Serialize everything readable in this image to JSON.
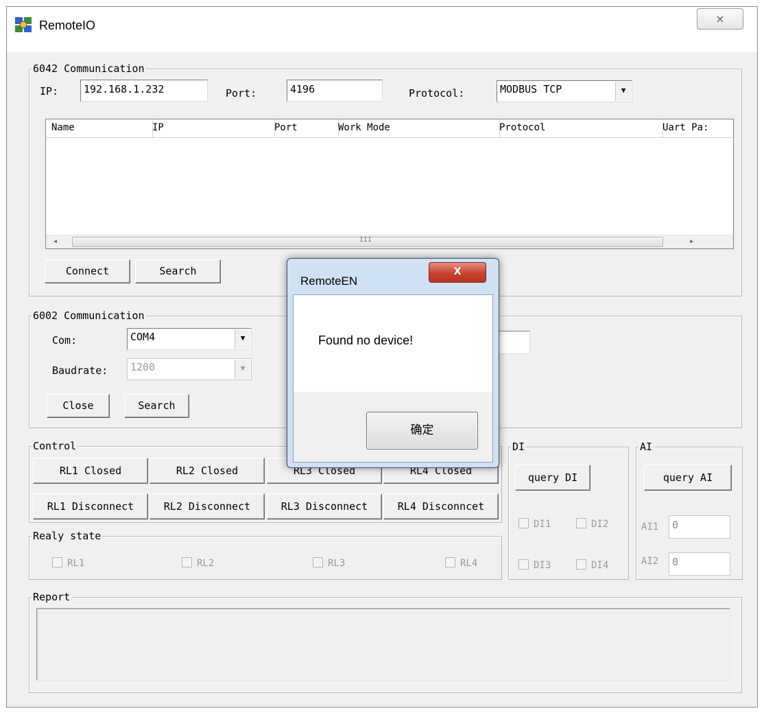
{
  "window": {
    "title": "RemoteIO",
    "close_glyph": "⨯"
  },
  "comm6042": {
    "group_label": "6042 Communication",
    "ip_label": "IP:",
    "ip_value": "192.168.1.232",
    "port_label": "Port:",
    "port_value": "4196",
    "protocol_label": "Protocol:",
    "protocol_value": "MODBUS TCP",
    "columns": [
      "Name",
      "IP",
      "Port",
      "Work Mode",
      "Protocol",
      "Uart Pa:"
    ],
    "rows": [],
    "scroll_left": "◂",
    "scroll_right": "▸",
    "scroll_grip": "III",
    "connect_label": "Connect",
    "search_label": "Search"
  },
  "comm6002": {
    "group_label": "6002 Communication",
    "com_label": "Com:",
    "com_value": "COM4",
    "baud_label": "Baudrate:",
    "baud_value": "1200",
    "close_label": "Close",
    "search_label": "Search"
  },
  "control": {
    "group_label": "Control",
    "closed_buttons": [
      "RL1 Closed",
      "RL2 Closed",
      "RL3 Closed",
      "RL4 Closed"
    ],
    "disconnect_buttons": [
      "RL1 Disconnect",
      "RL2 Disconnect",
      "RL3 Disconnect",
      "RL4 Disconncet"
    ]
  },
  "relay_state": {
    "group_label": "Realy state",
    "checkboxes": [
      "RL1",
      "RL2",
      "RL3",
      "RL4"
    ]
  },
  "di": {
    "group_label": "DI",
    "query_label": "query DI",
    "checkboxes": [
      "DI1",
      "DI2",
      "DI3",
      "DI4"
    ]
  },
  "ai": {
    "group_label": "AI",
    "query_label": "query AI",
    "ai1_label": "AI1",
    "ai1_value": "0",
    "ai2_label": "AI2",
    "ai2_value": "0"
  },
  "report": {
    "group_label": "Report",
    "text": ""
  },
  "dialog": {
    "title": "RemoteEN",
    "close_glyph": "X",
    "message": "Found no device!",
    "ok_label": "确定"
  },
  "icons": {
    "app": "remoteio-app-icon",
    "dropdown": "▼"
  }
}
